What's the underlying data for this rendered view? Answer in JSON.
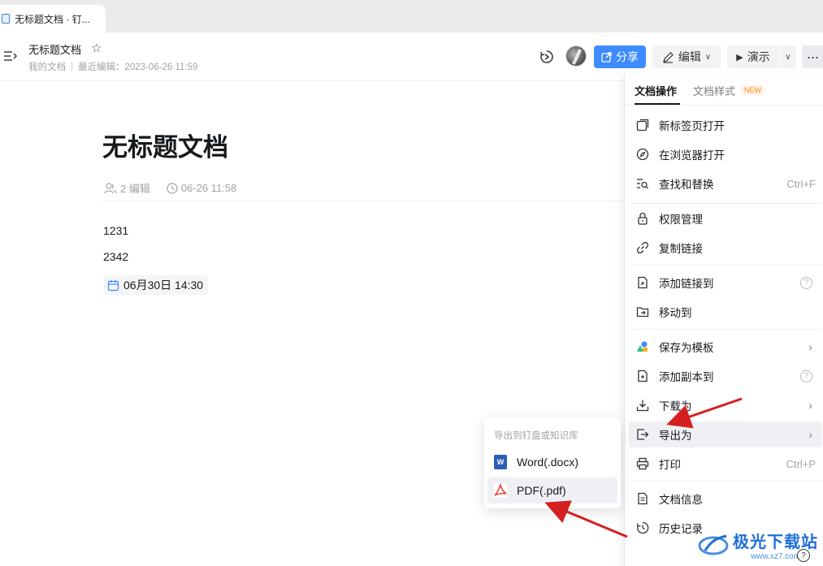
{
  "browser": {
    "tab_title": "无标题文档 · 钉..."
  },
  "header": {
    "doc_title": "无标题文档",
    "breadcrumb": "我的文档",
    "last_edit": "最近编辑：2023-06-26 11:59",
    "share_label": "分享",
    "edit_label": "编辑",
    "present_label": "演示",
    "more_label": "···"
  },
  "document": {
    "heading": "无标题文档",
    "editors": "2 编辑",
    "updated": "06-26 11:58",
    "paragraphs": [
      "1231",
      "2342"
    ],
    "date_chip": "06月30日 14:30"
  },
  "menu": {
    "tab_active": "文档操作",
    "tab_other": "文档样式",
    "new_badge": "NEW",
    "items": [
      {
        "label": "新标签页打开",
        "icon": "new-tab-icon"
      },
      {
        "label": "在浏览器打开",
        "icon": "compass-icon"
      },
      {
        "label": "查找和替换",
        "icon": "find-replace-icon",
        "shortcut": "Ctrl+F"
      },
      {
        "label": "权限管理",
        "icon": "lock-icon"
      },
      {
        "label": "复制链接",
        "icon": "link-icon"
      },
      {
        "label": "添加链接到",
        "icon": "add-link-icon"
      },
      {
        "label": "移动到",
        "icon": "move-folder-icon"
      },
      {
        "label": "保存为模板",
        "icon": "template-icon"
      },
      {
        "label": "添加副本到",
        "icon": "copy-icon"
      },
      {
        "label": "下载为",
        "icon": "download-icon"
      },
      {
        "label": "导出为",
        "icon": "export-icon"
      },
      {
        "label": "打印",
        "icon": "print-icon",
        "shortcut": "Ctrl+P"
      },
      {
        "label": "文档信息",
        "icon": "doc-info-icon"
      },
      {
        "label": "历史记录",
        "icon": "history-icon"
      }
    ]
  },
  "submenu": {
    "header": "导出到钉盘或知识库",
    "word_label": "Word(.docx)",
    "pdf_label": "PDF(.pdf)"
  },
  "watermark": {
    "title": "极光下载站",
    "url": "www.xz7.com"
  },
  "colors": {
    "accent": "#3d8bfd",
    "arrow": "#d42020",
    "pdf": "#e8473a",
    "word": "#2b5fb8"
  }
}
